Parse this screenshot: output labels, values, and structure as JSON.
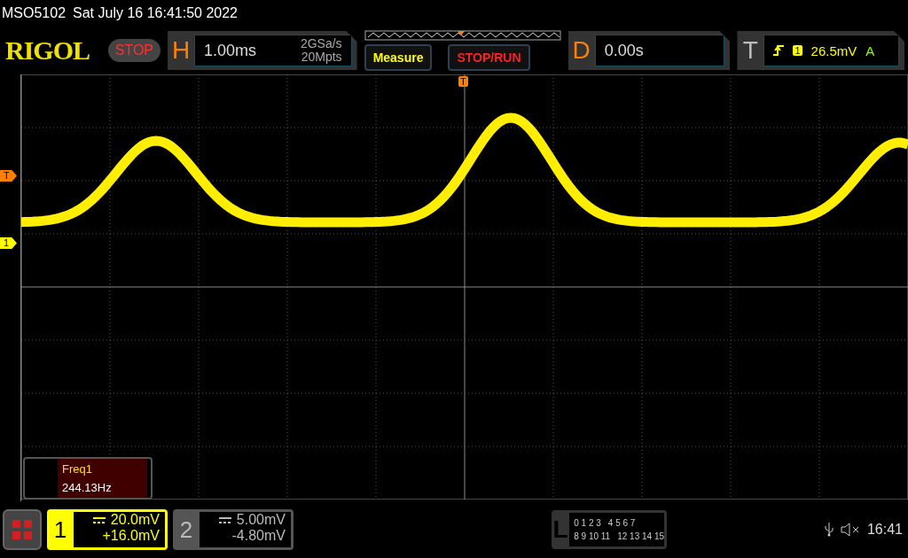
{
  "status_line": {
    "model": "MSO5102",
    "datetime": "Sat July 16 16:41:50 2022"
  },
  "toolbar": {
    "logo": "RIGOL",
    "run_state": "STOP",
    "horizontal": {
      "label": "H",
      "timebase": "1.00ms",
      "sample_rate": "2GSa/s",
      "memory_depth": "20Mpts"
    },
    "buttons": [
      "Measure",
      "STOP/RUN"
    ],
    "delay": {
      "label": "D",
      "value": "0.00s"
    },
    "trigger": {
      "label": "T",
      "source": "1",
      "level": "26.5mV",
      "mode": "A"
    }
  },
  "screen": {
    "trigger_position_marker": "T",
    "markers": [
      {
        "label": "T",
        "color": "#ff7f00"
      },
      {
        "label": "1",
        "color": "#ffff00"
      }
    ],
    "measurement": {
      "name": "Freq1",
      "value": "244.13Hz"
    }
  },
  "channels": [
    {
      "number": "1",
      "scale": "20.0mV",
      "offset": "+16.0mV",
      "selected": true
    },
    {
      "number": "2",
      "scale": "5.00mV",
      "offset": "-4.80mV",
      "selected": false
    }
  ],
  "logic": {
    "label": "L",
    "bits_row1": [
      "0 1 2 3",
      "4 5 6 7"
    ],
    "bits_row2": [
      "8 9 10 11",
      "12 13 14 15"
    ]
  },
  "status": {
    "clock": "16:41"
  }
}
